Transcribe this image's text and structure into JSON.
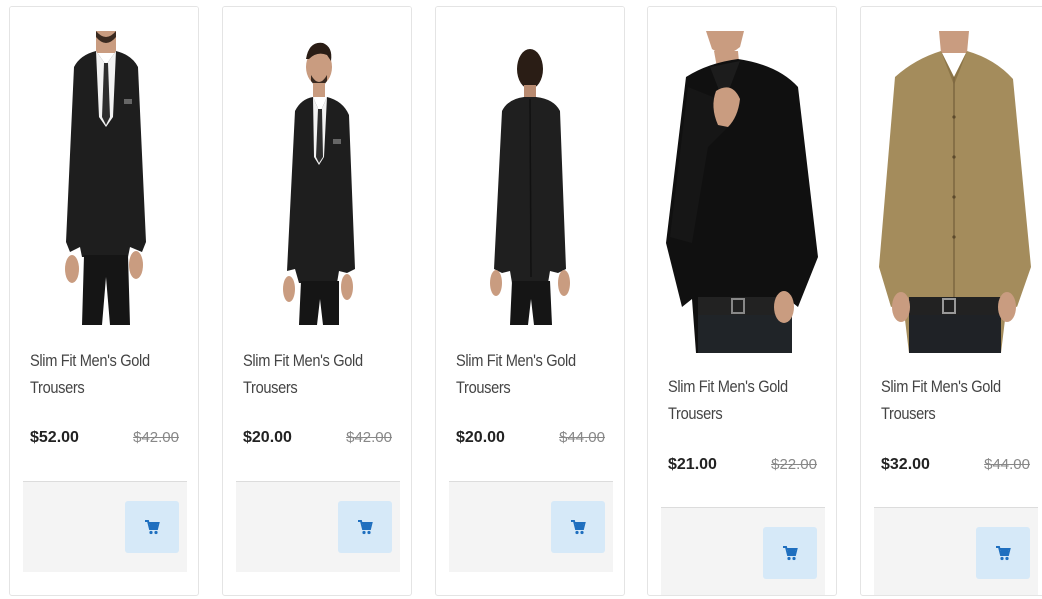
{
  "products": [
    {
      "name": "Slim Fit Men's Gold Trousers",
      "price": "$52.00",
      "old_price": "$42.00",
      "image": "black-suit-front"
    },
    {
      "name": "Slim Fit Men's Gold Trousers",
      "price": "$20.00",
      "old_price": "$42.00",
      "image": "black-suit-angle"
    },
    {
      "name": "Slim Fit Men's Gold Trousers",
      "price": "$20.00",
      "old_price": "$44.00",
      "image": "black-suit-back"
    },
    {
      "name": "Slim Fit Men's Gold Trousers",
      "price": "$21.00",
      "old_price": "$22.00",
      "image": "black-shirt"
    },
    {
      "name": "Slim Fit Men's Gold Trousers",
      "price": "$32.00",
      "old_price": "$44.00",
      "image": "khaki-shirt"
    }
  ],
  "cart_icon": "shopping-cart-icon",
  "colors": {
    "cart_button_bg": "#d6e9f8",
    "cart_icon": "#1f6fbf",
    "footer_bg": "#f4f4f4"
  }
}
